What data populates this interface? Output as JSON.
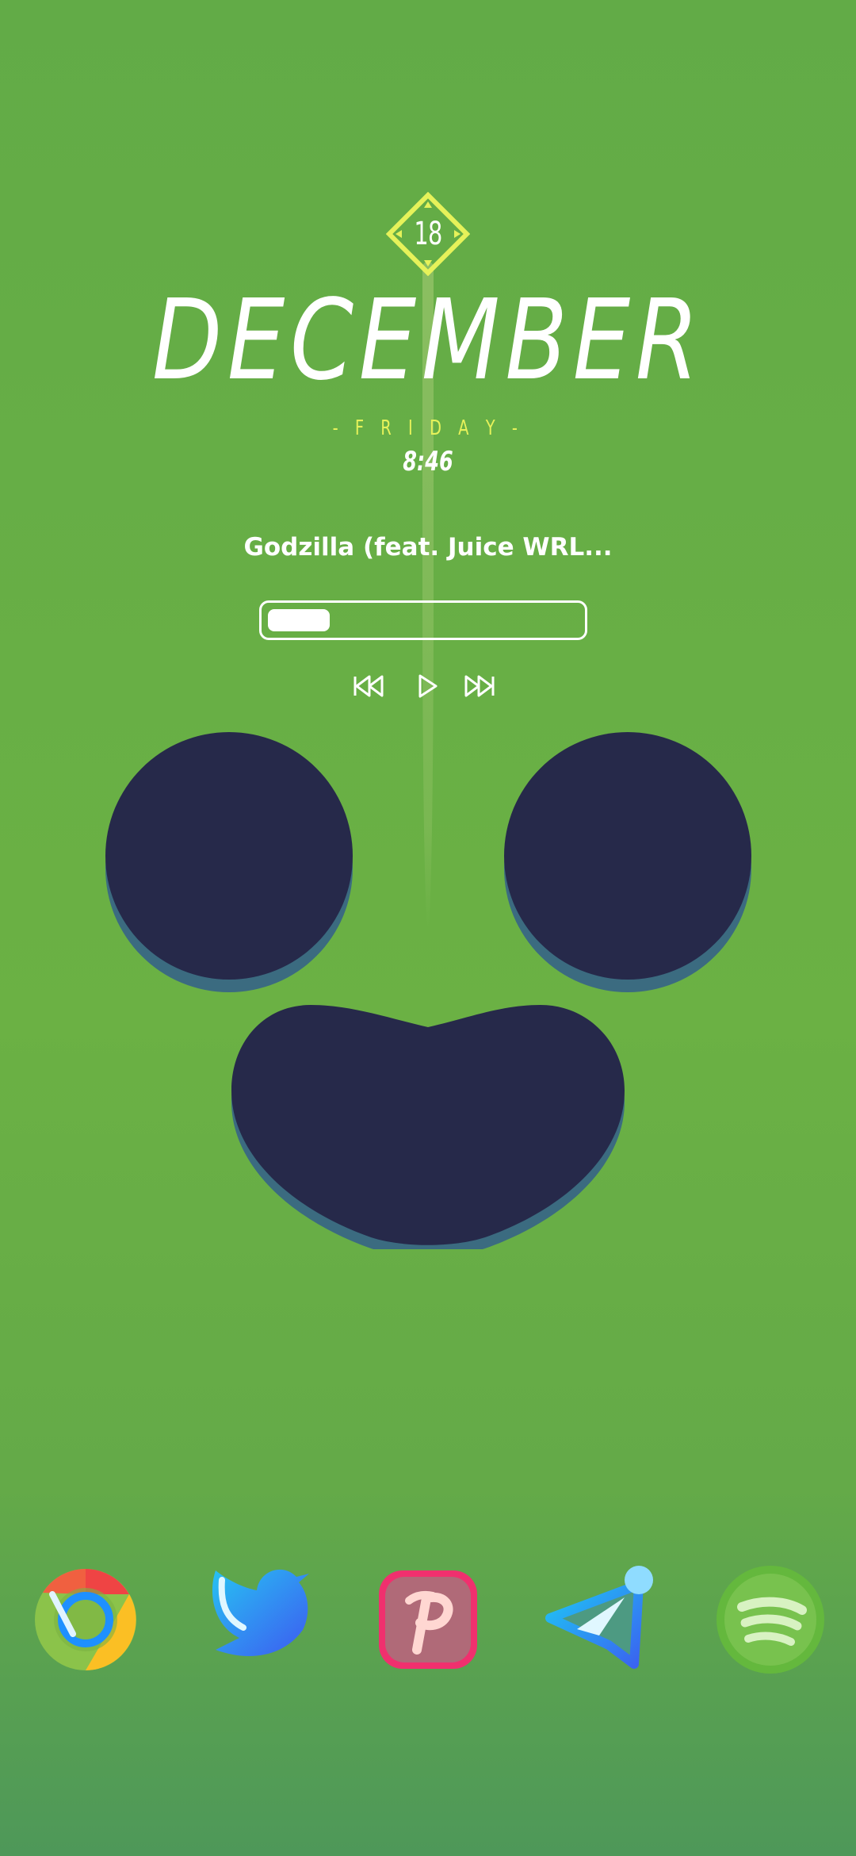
{
  "date": {
    "day": "18",
    "month": "DECEMBER",
    "weekday": "- F R I D A Y -",
    "time": "8:46"
  },
  "music": {
    "song_title": "Godzilla (feat. Juice WRL...",
    "progress": 0.2,
    "controls": [
      "previous",
      "play",
      "next"
    ]
  },
  "dock": {
    "apps": [
      "Chrome",
      "Twitter",
      "PicsArt",
      "Telegram",
      "Spotify"
    ]
  },
  "colors": {
    "background": "#6bb144",
    "accent_yellow": "#e6f25a",
    "face": "#26294a"
  }
}
